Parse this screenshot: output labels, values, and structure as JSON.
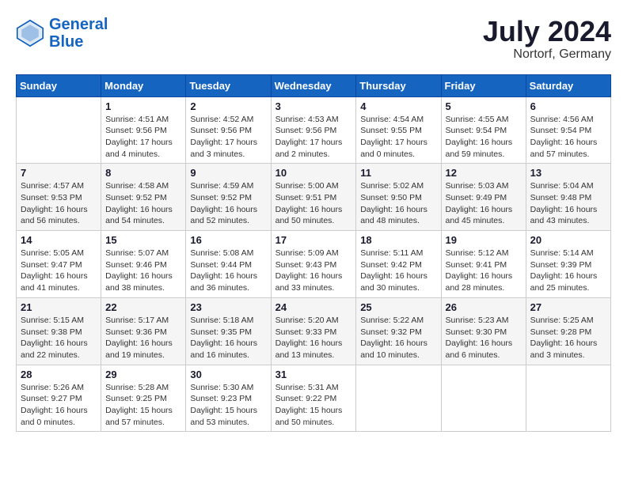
{
  "header": {
    "logo_line1": "General",
    "logo_line2": "Blue",
    "month_year": "July 2024",
    "location": "Nortorf, Germany"
  },
  "days_of_week": [
    "Sunday",
    "Monday",
    "Tuesday",
    "Wednesday",
    "Thursday",
    "Friday",
    "Saturday"
  ],
  "weeks": [
    [
      {
        "day": "",
        "info": ""
      },
      {
        "day": "1",
        "info": "Sunrise: 4:51 AM\nSunset: 9:56 PM\nDaylight: 17 hours\nand 4 minutes."
      },
      {
        "day": "2",
        "info": "Sunrise: 4:52 AM\nSunset: 9:56 PM\nDaylight: 17 hours\nand 3 minutes."
      },
      {
        "day": "3",
        "info": "Sunrise: 4:53 AM\nSunset: 9:56 PM\nDaylight: 17 hours\nand 2 minutes."
      },
      {
        "day": "4",
        "info": "Sunrise: 4:54 AM\nSunset: 9:55 PM\nDaylight: 17 hours\nand 0 minutes."
      },
      {
        "day": "5",
        "info": "Sunrise: 4:55 AM\nSunset: 9:54 PM\nDaylight: 16 hours\nand 59 minutes."
      },
      {
        "day": "6",
        "info": "Sunrise: 4:56 AM\nSunset: 9:54 PM\nDaylight: 16 hours\nand 57 minutes."
      }
    ],
    [
      {
        "day": "7",
        "info": "Sunrise: 4:57 AM\nSunset: 9:53 PM\nDaylight: 16 hours\nand 56 minutes."
      },
      {
        "day": "8",
        "info": "Sunrise: 4:58 AM\nSunset: 9:52 PM\nDaylight: 16 hours\nand 54 minutes."
      },
      {
        "day": "9",
        "info": "Sunrise: 4:59 AM\nSunset: 9:52 PM\nDaylight: 16 hours\nand 52 minutes."
      },
      {
        "day": "10",
        "info": "Sunrise: 5:00 AM\nSunset: 9:51 PM\nDaylight: 16 hours\nand 50 minutes."
      },
      {
        "day": "11",
        "info": "Sunrise: 5:02 AM\nSunset: 9:50 PM\nDaylight: 16 hours\nand 48 minutes."
      },
      {
        "day": "12",
        "info": "Sunrise: 5:03 AM\nSunset: 9:49 PM\nDaylight: 16 hours\nand 45 minutes."
      },
      {
        "day": "13",
        "info": "Sunrise: 5:04 AM\nSunset: 9:48 PM\nDaylight: 16 hours\nand 43 minutes."
      }
    ],
    [
      {
        "day": "14",
        "info": "Sunrise: 5:05 AM\nSunset: 9:47 PM\nDaylight: 16 hours\nand 41 minutes."
      },
      {
        "day": "15",
        "info": "Sunrise: 5:07 AM\nSunset: 9:46 PM\nDaylight: 16 hours\nand 38 minutes."
      },
      {
        "day": "16",
        "info": "Sunrise: 5:08 AM\nSunset: 9:44 PM\nDaylight: 16 hours\nand 36 minutes."
      },
      {
        "day": "17",
        "info": "Sunrise: 5:09 AM\nSunset: 9:43 PM\nDaylight: 16 hours\nand 33 minutes."
      },
      {
        "day": "18",
        "info": "Sunrise: 5:11 AM\nSunset: 9:42 PM\nDaylight: 16 hours\nand 30 minutes."
      },
      {
        "day": "19",
        "info": "Sunrise: 5:12 AM\nSunset: 9:41 PM\nDaylight: 16 hours\nand 28 minutes."
      },
      {
        "day": "20",
        "info": "Sunrise: 5:14 AM\nSunset: 9:39 PM\nDaylight: 16 hours\nand 25 minutes."
      }
    ],
    [
      {
        "day": "21",
        "info": "Sunrise: 5:15 AM\nSunset: 9:38 PM\nDaylight: 16 hours\nand 22 minutes."
      },
      {
        "day": "22",
        "info": "Sunrise: 5:17 AM\nSunset: 9:36 PM\nDaylight: 16 hours\nand 19 minutes."
      },
      {
        "day": "23",
        "info": "Sunrise: 5:18 AM\nSunset: 9:35 PM\nDaylight: 16 hours\nand 16 minutes."
      },
      {
        "day": "24",
        "info": "Sunrise: 5:20 AM\nSunset: 9:33 PM\nDaylight: 16 hours\nand 13 minutes."
      },
      {
        "day": "25",
        "info": "Sunrise: 5:22 AM\nSunset: 9:32 PM\nDaylight: 16 hours\nand 10 minutes."
      },
      {
        "day": "26",
        "info": "Sunrise: 5:23 AM\nSunset: 9:30 PM\nDaylight: 16 hours\nand 6 minutes."
      },
      {
        "day": "27",
        "info": "Sunrise: 5:25 AM\nSunset: 9:28 PM\nDaylight: 16 hours\nand 3 minutes."
      }
    ],
    [
      {
        "day": "28",
        "info": "Sunrise: 5:26 AM\nSunset: 9:27 PM\nDaylight: 16 hours\nand 0 minutes."
      },
      {
        "day": "29",
        "info": "Sunrise: 5:28 AM\nSunset: 9:25 PM\nDaylight: 15 hours\nand 57 minutes."
      },
      {
        "day": "30",
        "info": "Sunrise: 5:30 AM\nSunset: 9:23 PM\nDaylight: 15 hours\nand 53 minutes."
      },
      {
        "day": "31",
        "info": "Sunrise: 5:31 AM\nSunset: 9:22 PM\nDaylight: 15 hours\nand 50 minutes."
      },
      {
        "day": "",
        "info": ""
      },
      {
        "day": "",
        "info": ""
      },
      {
        "day": "",
        "info": ""
      }
    ]
  ]
}
